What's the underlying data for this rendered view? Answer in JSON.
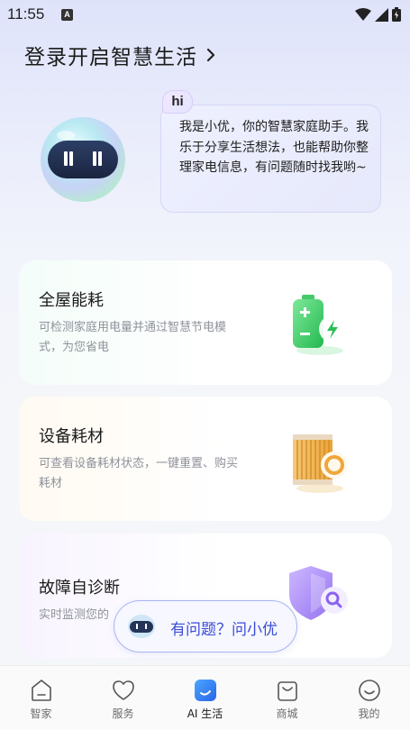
{
  "status_bar": {
    "time": "11:55",
    "indicator": "A"
  },
  "header": {
    "login_text": "登录开启智慧生活"
  },
  "assistant": {
    "hi": "hi",
    "message": "我是小优，你的智慧家庭助手。我乐于分享生活想法，也能帮助你整理家电信息，有问题随时找我哟~"
  },
  "cards": [
    {
      "title": "全屋能耗",
      "desc": "可检测家庭用电量并通过智慧节电模式，为您省电",
      "icon": "battery-icon"
    },
    {
      "title": "设备耗材",
      "desc": "可查看设备耗材状态，一键重置、购买耗材",
      "icon": "filter-icon"
    },
    {
      "title": "故障自诊断",
      "desc": "实时监测您的",
      "icon": "shield-search-icon"
    }
  ],
  "ask": {
    "label": "有问题？问小优"
  },
  "nav": [
    {
      "label": "智家",
      "icon": "home-icon"
    },
    {
      "label": "服务",
      "icon": "heart-icon"
    },
    {
      "label": "AI 生活",
      "icon": "ai-life-icon",
      "active": true
    },
    {
      "label": "商城",
      "icon": "shop-bag-icon"
    },
    {
      "label": "我的",
      "icon": "profile-icon"
    }
  ],
  "colors": {
    "accent": "#3a4cd6",
    "active_nav": "#2f7df6",
    "battery": "#3fcf6a",
    "filter": "#f0a63a",
    "shield": "#9b7af0"
  }
}
